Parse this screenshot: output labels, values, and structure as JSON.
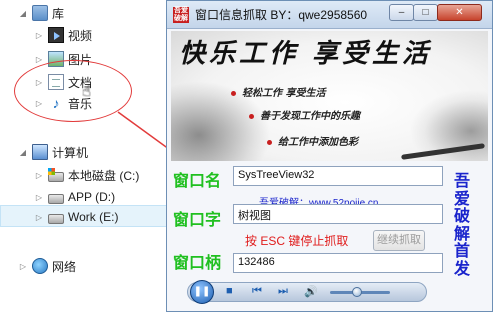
{
  "tree": {
    "items": [
      {
        "label": "库"
      },
      {
        "label": "视频"
      },
      {
        "label": "图片"
      },
      {
        "label": "文档"
      },
      {
        "label": "音乐"
      },
      {
        "label": "计算机"
      },
      {
        "label": "本地磁盘 (C:)"
      },
      {
        "label": "APP (D:)"
      },
      {
        "label": "Work (E:)"
      },
      {
        "label": "网络"
      }
    ],
    "arrow_collapsed": "▷",
    "arrow_expanded": "◢"
  },
  "window": {
    "title": "窗口信息抓取 BY：qwe2958560",
    "icon_text": "吾爱破解",
    "min_label": "–",
    "max_label": "□",
    "close_label": "✕",
    "banner": {
      "title": "快乐工作 享受生活",
      "lines": [
        "轻松工作 享受生活",
        "善于发现工作中的乐趣",
        "给工作中添加色彩"
      ]
    },
    "labels": {
      "window_name": "窗口名",
      "window_text": "窗口字",
      "window_handle": "窗口柄"
    },
    "fields": {
      "window_name": "SysTreeView32",
      "window_text": "树视图",
      "window_handle": "132486"
    },
    "brand_link": "吾爱破解：www.52pojie.cn",
    "stop_note": "按 ESC 键停止抓取",
    "resume_button": "继续抓取",
    "vertical_brand": [
      "吾",
      "爱",
      "破",
      "解",
      "首",
      "发"
    ],
    "player": {
      "play_icon": "❚❚",
      "stop_icon": "■",
      "prev_icon": "⏮",
      "next_icon": "⏭",
      "volume_icon": "🔊"
    }
  },
  "colors": {
    "green_label": "#20c020",
    "red_text": "#e01c1c",
    "blue_text": "#1a24cc"
  }
}
